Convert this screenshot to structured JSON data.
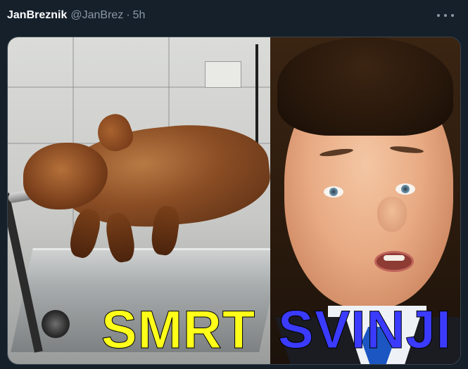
{
  "tweet": {
    "display_name": "JanBreznik",
    "handle": "@JanBrez",
    "separator": "·",
    "time": "5h",
    "more_icon": "more-horizontal-icon"
  },
  "media": {
    "caption_left": "SMRT",
    "caption_right": "SVINJI",
    "colors": {
      "caption_left": "#ffff1a",
      "caption_right": "#3b3bff",
      "background": "#15202b",
      "secondary_text": "#8b98a5"
    }
  }
}
